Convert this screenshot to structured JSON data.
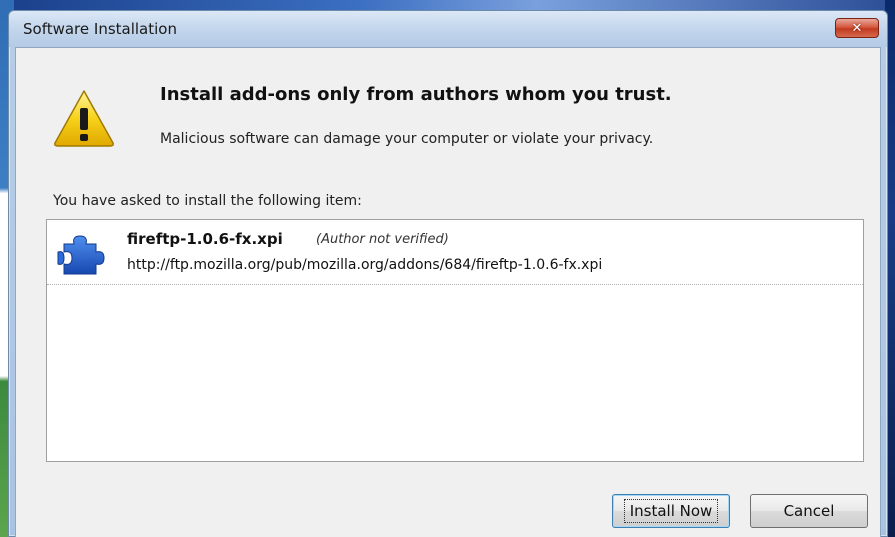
{
  "window": {
    "title": "Software Installation",
    "close_glyph": "✕"
  },
  "warning": {
    "icon": "warning-triangle-icon",
    "heading": "Install add-ons only from authors whom you trust.",
    "subtext": "Malicious software can damage your computer or violate your privacy."
  },
  "list": {
    "intro": "You have asked to install the following item:",
    "items": [
      {
        "icon": "puzzle-piece-icon",
        "name": "fireftp-1.0.6-fx.xpi",
        "author_status": "(Author not verified)",
        "url": "http://ftp.mozilla.org/pub/mozilla.org/addons/684/fireftp-1.0.6-fx.xpi"
      }
    ]
  },
  "buttons": {
    "install": "Install Now",
    "cancel": "Cancel"
  },
  "colors": {
    "warning_yellow": "#f5c400",
    "puzzle_blue": "#1f5fd0",
    "close_red": "#c23a1e"
  }
}
